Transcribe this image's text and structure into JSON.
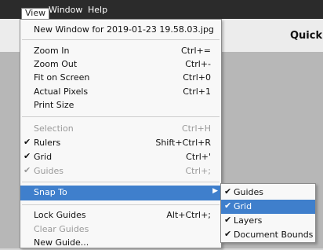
{
  "menubar": {
    "items": [
      {
        "label": "View"
      },
      {
        "label": "Window"
      },
      {
        "label": "Help"
      }
    ]
  },
  "toolbar": {
    "quick_label": "Quick"
  },
  "view_menu": {
    "items": [
      {
        "label": "New Window for 2019-01-23 19.58.03.jpg",
        "shortcut": ""
      },
      {
        "label": "Zoom In",
        "shortcut": "Ctrl+="
      },
      {
        "label": "Zoom Out",
        "shortcut": "Ctrl+-"
      },
      {
        "label": "Fit on Screen",
        "shortcut": "Ctrl+0"
      },
      {
        "label": "Actual Pixels",
        "shortcut": "Ctrl+1"
      },
      {
        "label": "Print Size",
        "shortcut": ""
      },
      {
        "label": "Selection",
        "shortcut": "Ctrl+H",
        "enabled": false
      },
      {
        "label": "Rulers",
        "shortcut": "Shift+Ctrl+R",
        "checked": true
      },
      {
        "label": "Grid",
        "shortcut": "Ctrl+'",
        "checked": true
      },
      {
        "label": "Guides",
        "shortcut": "Ctrl+;",
        "checked": true,
        "enabled": false
      },
      {
        "label": "Snap To",
        "shortcut": "",
        "highlighted": true,
        "has_submenu": true
      },
      {
        "label": "Lock Guides",
        "shortcut": "Alt+Ctrl+;"
      },
      {
        "label": "Clear Guides",
        "shortcut": "",
        "enabled": false
      },
      {
        "label": "New Guide...",
        "shortcut": ""
      }
    ],
    "check_glyph": "✔",
    "submenu_arrow_glyph": "▶"
  },
  "snap_to_submenu": {
    "items": [
      {
        "label": "Guides",
        "checked": true
      },
      {
        "label": "Grid",
        "checked": true,
        "highlighted": true
      },
      {
        "label": "Layers",
        "checked": true
      },
      {
        "label": "Document Bounds",
        "checked": true
      }
    ]
  },
  "colors": {
    "highlight": "#3f7fcc",
    "menubar_bg": "#2b2b2b",
    "disabled_text": "#9a9a9a"
  }
}
